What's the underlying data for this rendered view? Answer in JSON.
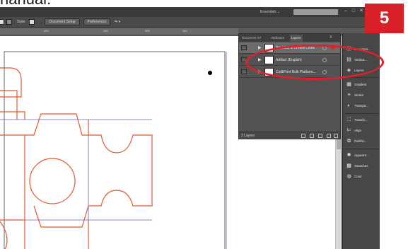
{
  "manual": {
    "heading_fragment": "nanual."
  },
  "app": {
    "workspace": "Essentials ⌄",
    "window_controls": [
      "–",
      "□",
      "✕"
    ]
  },
  "controlbar": {
    "style_label": "Style:",
    "document_setup": "Document Setup",
    "preferences": "Preferences"
  },
  "ruler": {
    "ticks": [
      "200",
      "250",
      "300",
      "350"
    ]
  },
  "layers_panel": {
    "tabs": [
      "Document Inf",
      "Attributes",
      "Layers"
    ],
    "menu_icon": "≡",
    "layers": [
      {
        "name": "Print/Cut & Crease Lines",
        "selected": true
      },
      {
        "name": "Artifact (English)",
        "selected": false
      },
      {
        "name": "Cut&Print Bulk Platform...",
        "selected": false
      }
    ],
    "footer_count": "3 Layers"
  },
  "dock": {
    "items": [
      {
        "icon": "info-icon",
        "glyph": "ⓘ",
        "label": "Documen..."
      },
      {
        "icon": "attributes-icon",
        "glyph": "▤",
        "label": "Attribut..."
      },
      {
        "icon": "layers-icon",
        "glyph": "◈",
        "label": "Layers"
      },
      {
        "icon": "gradient-icon",
        "glyph": "▦",
        "label": "Gradient"
      },
      {
        "icon": "stroke-icon",
        "glyph": "≡",
        "label": "Stroke"
      },
      {
        "icon": "transparency-icon",
        "glyph": "◐",
        "label": "Transpa..."
      },
      {
        "icon": "transform-icon",
        "glyph": "⛶",
        "label": "Transfo..."
      },
      {
        "icon": "align-icon",
        "glyph": "⊨",
        "label": "Align"
      },
      {
        "icon": "pathfinder-icon",
        "glyph": "⧉",
        "label": "Pathfin..."
      },
      {
        "icon": "appearance-icon",
        "glyph": "✺",
        "label": "Appeara..."
      },
      {
        "icon": "swatches-icon",
        "glyph": "▩",
        "label": "Swatches"
      },
      {
        "icon": "color-icon",
        "glyph": "◍",
        "label": "Color"
      }
    ]
  },
  "annotation": {
    "step_number": "5"
  },
  "colors": {
    "accent_red": "#d72027",
    "dieline_orange": "#e4572e",
    "artboard_blue": "#5b5bc7"
  }
}
